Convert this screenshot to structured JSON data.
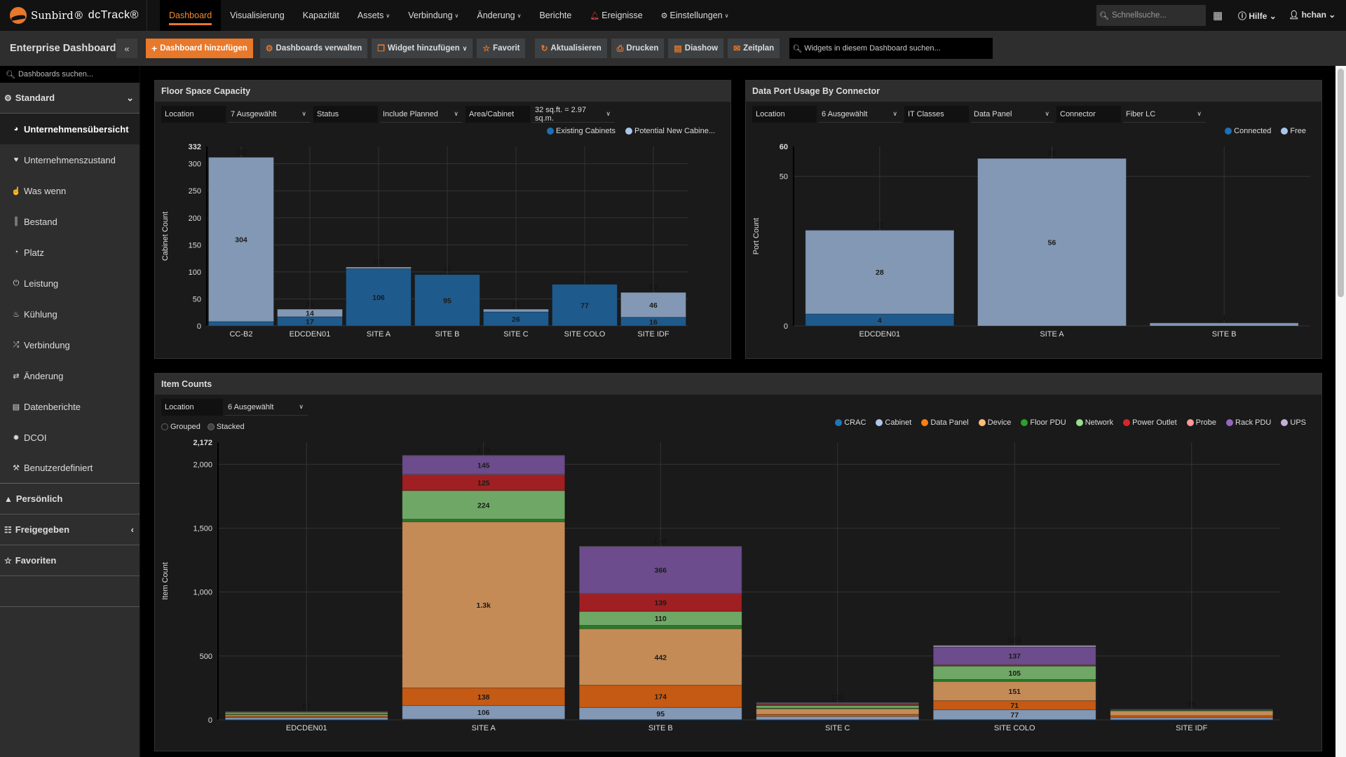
{
  "app": {
    "brand": "Sunbird®",
    "product": "dcTrack®"
  },
  "nav": {
    "items": [
      {
        "label": "Dashboard",
        "active": true,
        "dropdown": false
      },
      {
        "label": "Visualisierung",
        "dropdown": false
      },
      {
        "label": "Kapazität",
        "dropdown": false
      },
      {
        "label": "Assets",
        "dropdown": true
      },
      {
        "label": "Verbindung",
        "dropdown": true
      },
      {
        "label": "Änderung",
        "dropdown": true
      },
      {
        "label": "Berichte",
        "dropdown": false
      },
      {
        "label": "Ereignisse",
        "icon": "bell-icon",
        "dropdown": false
      },
      {
        "label": "Einstellungen",
        "icon": "gear-icon",
        "dropdown": true
      }
    ],
    "quick_search_placeholder": "Schnellsuche...",
    "help_label": "Hilfe",
    "user_label": "hchan"
  },
  "toolbar": {
    "title": "Enterprise Dashboard",
    "buttons": [
      {
        "label": "Dashboard hinzufügen",
        "icon": "plus-icon",
        "primary": true
      },
      {
        "label": "Dashboards verwalten",
        "icon": "gear-icon"
      },
      {
        "label": "Widget hinzufügen",
        "icon": "widget-icon",
        "dropdown": true
      },
      {
        "label": "Favorit",
        "icon": "star-icon"
      },
      {
        "label": "Aktualisieren",
        "icon": "refresh-icon"
      },
      {
        "label": "Drucken",
        "icon": "print-icon"
      },
      {
        "label": "Diashow",
        "icon": "film-icon"
      },
      {
        "label": "Zeitplan",
        "icon": "envelope-icon"
      }
    ],
    "widget_search_placeholder": "Widgets in diesem Dashboard suchen..."
  },
  "sidebar": {
    "search_placeholder": "Dashboards suchen...",
    "standard_label": "Standard",
    "items": [
      {
        "label": "Unternehmensübersicht",
        "icon": "globe-icon",
        "active": true
      },
      {
        "label": "Unternehmenszustand",
        "icon": "heartbeat-icon"
      },
      {
        "label": "Was wenn",
        "icon": "thumbs-up-icon"
      },
      {
        "label": "Bestand",
        "icon": "barcode-icon"
      },
      {
        "label": "Platz",
        "icon": "gauge-icon"
      },
      {
        "label": "Leistung",
        "icon": "power-icon"
      },
      {
        "label": "Kühlung",
        "icon": "fire-icon"
      },
      {
        "label": "Verbindung",
        "icon": "shuffle-icon"
      },
      {
        "label": "Änderung",
        "icon": "exchange-icon"
      },
      {
        "label": "Datenberichte",
        "icon": "report-icon"
      },
      {
        "label": "DCOI",
        "icon": "badge-icon"
      },
      {
        "label": "Benutzerdefiniert",
        "icon": "wrench-icon"
      }
    ],
    "groups": [
      {
        "label": "Persönlich",
        "icon": "user-icon"
      },
      {
        "label": "Freigegeben",
        "icon": "users-icon"
      },
      {
        "label": "Favoriten",
        "icon": "star-icon"
      }
    ]
  },
  "widgets": {
    "floor": {
      "title": "Floor Space Capacity",
      "filters": [
        {
          "label": "Location",
          "value": "7 Ausgewählt"
        },
        {
          "label": "Status",
          "value": "Include Planned"
        },
        {
          "label": "Area/Cabinet",
          "value": "32 sq.ft. = 2.97 sq.m."
        }
      ]
    },
    "port": {
      "title": "Data Port Usage By Connector",
      "filters": [
        {
          "label": "Location",
          "value": "6 Ausgewählt"
        },
        {
          "label": "IT Classes",
          "value": "Data Panel"
        },
        {
          "label": "Connector",
          "value": "Fiber LC"
        }
      ]
    },
    "items": {
      "title": "Item Counts",
      "filters": [
        {
          "label": "Location",
          "value": "6 Ausgewählt"
        }
      ],
      "radio_grouped": "Grouped",
      "radio_stacked": "Stacked",
      "selected_mode": "Stacked"
    }
  },
  "chart_data": [
    {
      "type": "bar",
      "stacked": true,
      "title": "Floor Space Capacity",
      "ylabel": "Cabinet Count",
      "ylim": [
        0,
        332
      ],
      "yticks": [
        "0",
        "50",
        "100",
        "150",
        "200",
        "250",
        "300",
        "332"
      ],
      "categories": [
        "CC-B2",
        "EDCDEN01",
        "SITE A",
        "SITE B",
        "SITE C",
        "SITE COLO",
        "SITE IDF"
      ],
      "series": [
        {
          "name": "Existing Cabinets",
          "color": "#1f5a8c",
          "values": [
            8,
            17,
            106,
            95,
            26,
            77,
            16
          ]
        },
        {
          "name": "Potential New Cabine...",
          "color": "#8298b4",
          "values": [
            304,
            14,
            3,
            0,
            5,
            0,
            46
          ]
        }
      ],
      "segment_labels": [
        [
          "",
          "304"
        ],
        [
          "17",
          "14"
        ],
        [
          "106",
          ""
        ],
        [
          "95",
          ""
        ],
        [
          "26",
          ""
        ],
        [
          "77",
          ""
        ],
        [
          "16",
          "46"
        ]
      ],
      "totals": [
        "312",
        "31",
        "109",
        "95",
        "31",
        "77",
        "62"
      ],
      "legend": "top-right"
    },
    {
      "type": "bar",
      "stacked": true,
      "title": "Data Port Usage By Connector",
      "ylabel": "Port Count",
      "ylim": [
        0,
        60
      ],
      "yticks": [
        "0",
        "50",
        "60"
      ],
      "categories": [
        "EDCDEN01",
        "SITE A",
        "SITE B"
      ],
      "series": [
        {
          "name": "Connected",
          "color": "#1f5a8c",
          "values": [
            4,
            0,
            0
          ]
        },
        {
          "name": "Free",
          "color": "#8298b4",
          "values": [
            28,
            56,
            1
          ]
        }
      ],
      "segment_labels": [
        [
          "4",
          "28"
        ],
        [
          "",
          "56"
        ],
        [
          "",
          ""
        ]
      ],
      "totals": [
        "32",
        "56",
        "1"
      ],
      "legend": "top-right"
    },
    {
      "type": "bar",
      "stacked": true,
      "title": "Item Counts",
      "ylabel": "Item Count",
      "ylim": [
        0,
        2172
      ],
      "yticks": [
        "0",
        "500",
        "1,000",
        "1,500",
        "2,000",
        "2,172"
      ],
      "categories": [
        "EDCDEN01",
        "SITE A",
        "SITE B",
        "SITE C",
        "SITE COLO",
        "SITE IDF"
      ],
      "series": [
        {
          "name": "CRAC",
          "color": "#1f77b4",
          "values": [
            1,
            6,
            2,
            1,
            2,
            1
          ]
        },
        {
          "name": "Cabinet",
          "color": "#aec7e8",
          "values": [
            17,
            106,
            95,
            26,
            77,
            16
          ]
        },
        {
          "name": "Data Panel",
          "color": "#ff7f0e",
          "values": [
            10,
            138,
            174,
            16,
            71,
            16
          ]
        },
        {
          "name": "Device",
          "color": "#ffbb78",
          "values": [
            15,
            1300,
            442,
            45,
            151,
            40
          ]
        },
        {
          "name": "Floor PDU",
          "color": "#2ca02c",
          "values": [
            2,
            20,
            26,
            4,
            15,
            2
          ]
        },
        {
          "name": "Network",
          "color": "#98df8a",
          "values": [
            17,
            224,
            110,
            20,
            105,
            8
          ]
        },
        {
          "name": "Power Outlet",
          "color": "#d62728",
          "values": [
            2,
            125,
            139,
            8,
            10,
            1
          ]
        },
        {
          "name": "Probe",
          "color": "#ff9896",
          "values": [
            1,
            2,
            2,
            5,
            1,
            0
          ]
        },
        {
          "name": "Rack PDU",
          "color": "#9467bd",
          "values": [
            2,
            145,
            366,
            8,
            137,
            1
          ]
        },
        {
          "name": "UPS",
          "color": "#c5b0d5",
          "values": [
            0,
            4,
            2,
            2,
            14,
            0
          ]
        }
      ],
      "segment_labels_shown": {
        "SITE A": {
          "Cabinet": "106",
          "Data Panel": "138",
          "Device": "1.3k",
          "Network": "224",
          "Power Outlet": "125",
          "Rack PDU": "145"
        },
        "SITE B": {
          "Cabinet": "95",
          "Data Panel": "174",
          "Device": "442",
          "Network": "110",
          "Power Outlet": "139",
          "Rack PDU": "366"
        },
        "SITE COLO": {
          "Cabinet": "77",
          "Data Panel": "71",
          "Device": "151",
          "Network": "105",
          "Rack PDU": "137"
        }
      },
      "totals": [
        "67",
        "2.1k",
        "1.4k",
        "135",
        "583",
        "85"
      ],
      "legend": "top-right"
    }
  ]
}
